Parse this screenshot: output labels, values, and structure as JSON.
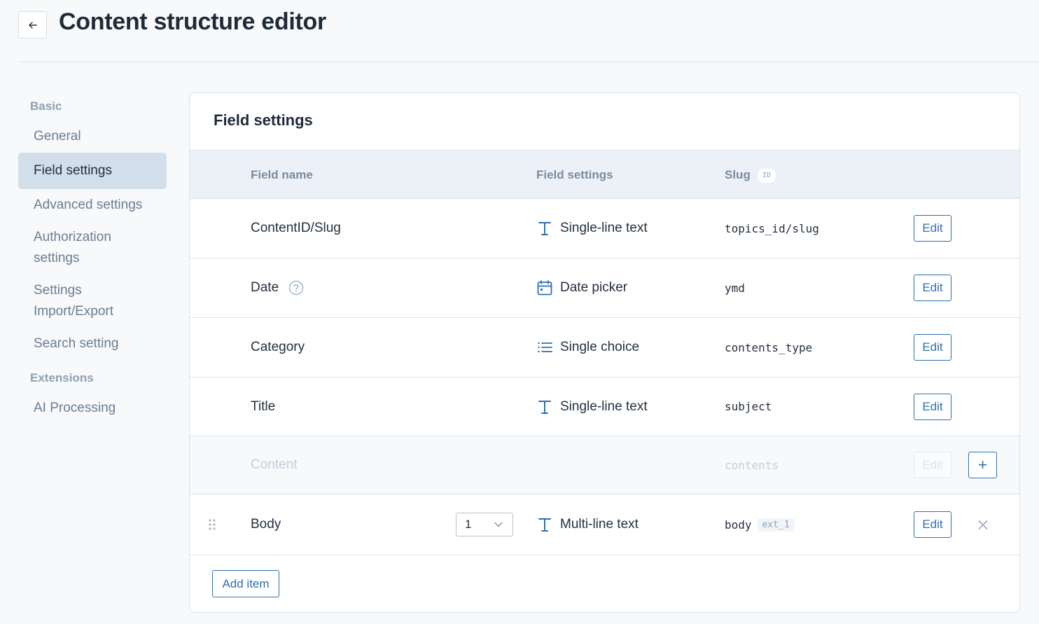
{
  "header": {
    "title": "Content structure editor",
    "back_icon": "arrow-left-icon"
  },
  "sidebar": {
    "groups": [
      {
        "label": "Basic",
        "items": [
          "General",
          "Field settings",
          "Advanced settings",
          "Authorization settings",
          "Settings Import/Export",
          "Search setting"
        ]
      },
      {
        "label": "Extensions",
        "items": [
          "AI Processing"
        ]
      }
    ],
    "active_item": "Field settings"
  },
  "panel": {
    "title": "Field settings",
    "columns": {
      "field_name": "Field name",
      "field_settings": "Field settings",
      "slug": "Slug",
      "slug_badge": "ID"
    },
    "rows": [
      {
        "name": "ContentID/Slug",
        "type": "Single-line text",
        "type_icon": "text-icon",
        "slug": "topics_id/slug",
        "edit": "Edit"
      },
      {
        "name": "Date",
        "type": "Date picker",
        "type_icon": "calendar-icon",
        "slug": "ymd",
        "edit": "Edit",
        "help_icon": "question-circle-icon"
      },
      {
        "name": "Category",
        "type": "Single choice",
        "type_icon": "list-icon",
        "slug": "contents_type",
        "edit": "Edit"
      },
      {
        "name": "Title",
        "type": "Single-line text",
        "type_icon": "text-icon",
        "slug": "subject",
        "edit": "Edit"
      },
      {
        "name": "Content",
        "type": "",
        "slug": "contents",
        "edit": "Edit",
        "disabled": true,
        "plus": "+"
      },
      {
        "name": "Body",
        "type": "Multi-line text",
        "type_icon": "text-icon",
        "slug": "body",
        "slug_badge": "ext_1",
        "edit": "Edit",
        "select_value": "1",
        "close": "×"
      }
    ],
    "add_item": "Add item"
  },
  "colors": {
    "accent": "#2f6fb3",
    "active_bg": "#d2deea",
    "header_bg": "#ebf1f7"
  }
}
